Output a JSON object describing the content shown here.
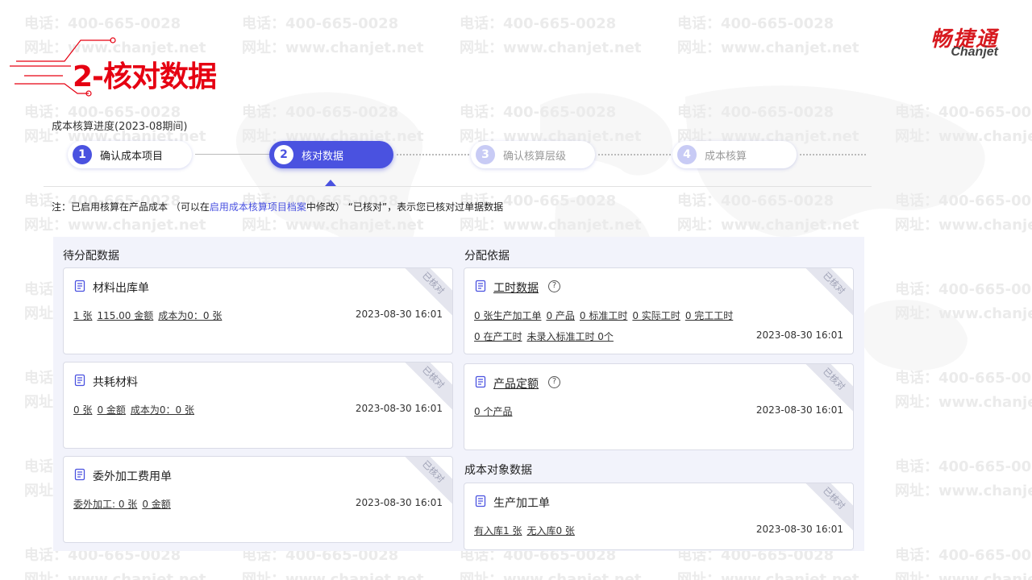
{
  "watermark": {
    "phone": "电话：400-665-0028",
    "site": "网址：www.chanjet.net"
  },
  "slide": {
    "title": "2-核对数据"
  },
  "logo": {
    "cn": "畅捷通",
    "en": "Chanjet"
  },
  "progress": {
    "label": "成本核算进度(2023-08期间)",
    "steps": [
      {
        "num": "1",
        "label": "确认成本项目"
      },
      {
        "num": "2",
        "label": "核对数据"
      },
      {
        "num": "3",
        "label": "确认核算层级"
      },
      {
        "num": "4",
        "label": "成本核算"
      }
    ]
  },
  "note": {
    "prefix": "注：已启用核算在产品成本 （可以在",
    "link": "启用成本核算项目档案",
    "suffix": "中修改） “已核对”，表示您已核对过单据数据"
  },
  "left": {
    "title": "待分配数据",
    "cards": [
      {
        "title": "材料出库单",
        "ribbon": "已核对",
        "links": [
          "1 张",
          "115.00 金额",
          "成本为0：0 张"
        ],
        "time": "2023-08-30 16:01"
      },
      {
        "title": "共耗材料",
        "ribbon": "已核对",
        "links": [
          "0 张",
          "0 金额",
          "成本为0：0 张"
        ],
        "time": "2023-08-30 16:01"
      },
      {
        "title": "委外加工费用单",
        "ribbon": "已核对",
        "links": [
          "委外加工: 0 张",
          "0 金额"
        ],
        "time": "2023-08-30 16:01"
      }
    ]
  },
  "right": {
    "title": "分配依据",
    "cards": [
      {
        "title": "工时数据",
        "ribbon": "已核对",
        "links1": [
          "0 张生产加工单",
          "0 产品",
          "0 标准工时",
          "0 实际工时",
          "0 完工工时"
        ],
        "links2": [
          "0 在产工时",
          "未录入标准工时 0个"
        ],
        "time": "2023-08-30 16:01"
      },
      {
        "title": "产品定额",
        "ribbon": "已核对",
        "links": [
          "0 个产品"
        ],
        "time": "2023-08-30 16:01"
      }
    ],
    "object_title": "成本对象数据",
    "object_card": {
      "title": "生产加工单",
      "ribbon": "已核对",
      "links": [
        "有入库1 张",
        "无入库0 张"
      ],
      "time": "2023-08-30 16:01"
    }
  },
  "colors": {
    "accent": "#4a52e0",
    "title_red": "#e60012",
    "panel_bg": "#f2f3fb"
  },
  "icons": {
    "doc": "document-list-icon",
    "help": "question-circle-icon"
  }
}
